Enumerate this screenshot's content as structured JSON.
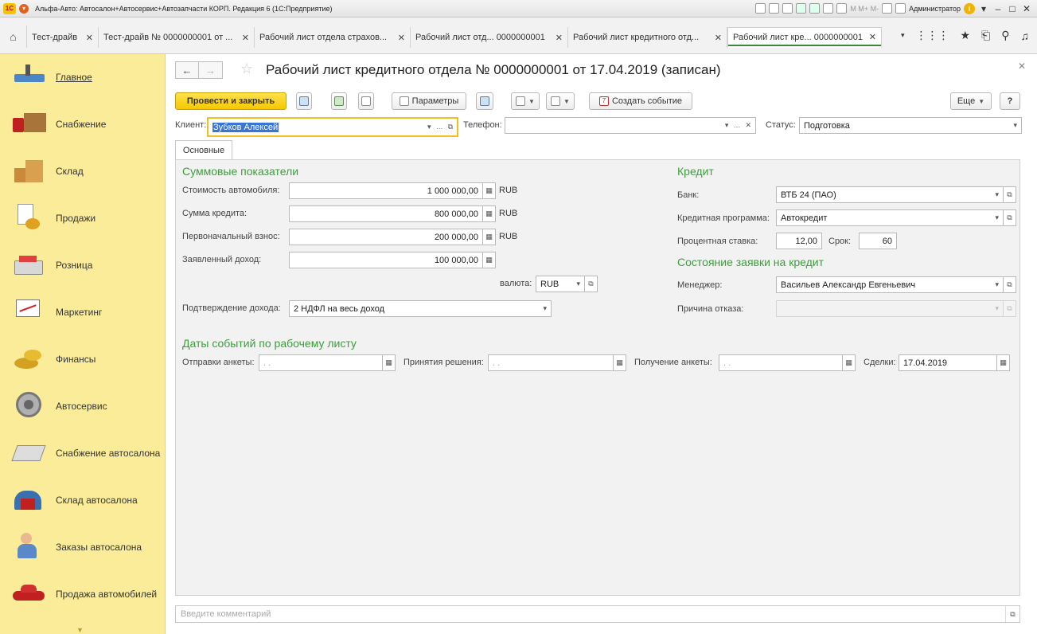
{
  "window": {
    "title": "Альфа-Авто: Автосалон+Автосервис+Автозапчасти КОРП. Редакция 6  (1С:Предприятие)",
    "user": "Администратор",
    "logo": "1С"
  },
  "tabs": [
    {
      "label": "Тест-драйв"
    },
    {
      "label": "Тест-драйв № 0000000001 от ..."
    },
    {
      "label": "Рабочий лист отдела страхов..."
    },
    {
      "label": "Рабочий лист отд... 0000000001"
    },
    {
      "label": "Рабочий лист кредитного отд..."
    },
    {
      "label": "Рабочий лист кре... 0000000001"
    }
  ],
  "sidebar": {
    "items": [
      {
        "label": "Главное"
      },
      {
        "label": "Снабжение"
      },
      {
        "label": "Склад"
      },
      {
        "label": "Продажи"
      },
      {
        "label": "Розница"
      },
      {
        "label": "Маркетинг"
      },
      {
        "label": "Финансы"
      },
      {
        "label": "Автосервис"
      },
      {
        "label": "Снабжение автосалона"
      },
      {
        "label": "Склад автосалона"
      },
      {
        "label": "Заказы автосалона"
      },
      {
        "label": "Продажа автомобилей"
      }
    ]
  },
  "form": {
    "title": "Рабочий лист кредитного отдела № 0000000001 от 17.04.2019 (записан)"
  },
  "toolbar": {
    "post_close": "Провести и закрыть",
    "params": "Параметры",
    "create_event": "Создать событие",
    "more": "Еще",
    "help": "?"
  },
  "header": {
    "client_label": "Клиент:",
    "client_value": "Зубков Алексей",
    "phone_label": "Телефон:",
    "phone_value": "",
    "status_label": "Статус:",
    "status_value": "Подготовка"
  },
  "page_tab": "Основные",
  "sums": {
    "title": "Суммовые показатели",
    "car_cost_label": "Стоимость автомобиля:",
    "car_cost_value": "1 000 000,00",
    "credit_label": "Сумма кредита:",
    "credit_value": "800 000,00",
    "down_label": "Первоначальный взнос:",
    "down_value": "200 000,00",
    "income_label": "Заявленный доход:",
    "income_value": "100 000,00",
    "currency_unit": "RUB",
    "currency_label": "валюта:",
    "currency_value": "RUB",
    "proof_label": "Подтверждение дохода:",
    "proof_value": "2 НДФЛ на весь доход"
  },
  "credit": {
    "title": "Кредит",
    "bank_label": "Банк:",
    "bank_value": "ВТБ 24 (ПАО)",
    "program_label": "Кредитная программа:",
    "program_value": "Автокредит",
    "rate_label": "Процентная ставка:",
    "rate_value": "12,00",
    "term_label": "Срок:",
    "term_value": "60"
  },
  "state": {
    "title": "Состояние заявки на кредит",
    "manager_label": "Менеджер:",
    "manager_value": "Васильев Александр Евгеньевич",
    "reason_label": "Причина отказа:",
    "reason_value": ""
  },
  "dates": {
    "title": "Даты событий по рабочему листу",
    "sent_label": "Отправки анкеты:",
    "sent_value": " .  .",
    "decision_label": "Принятия решения:",
    "decision_value": " .  .",
    "received_label": "Получение анкеты:",
    "received_value": " .  .",
    "deal_label": "Сделки:",
    "deal_value": "17.04.2019"
  },
  "comment": {
    "placeholder": "Введите комментарий"
  },
  "colors": {
    "sidebar_bg": "#fbec9a",
    "primary_button": "#f5c800",
    "section_title": "#3aa03a",
    "selection": "#3875d7"
  }
}
